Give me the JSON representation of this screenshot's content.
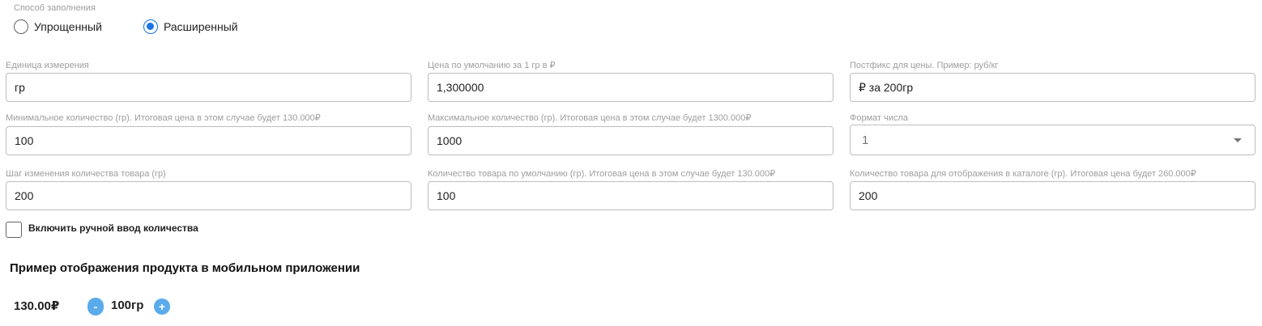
{
  "fill_mode": {
    "label": "Способ заполнения",
    "options": [
      {
        "label": "Упрощенный",
        "checked": false
      },
      {
        "label": "Расширенный",
        "checked": true
      }
    ]
  },
  "fields": {
    "unit": {
      "label": "Единица измерения",
      "value": "гр"
    },
    "default_price": {
      "label": "Цена по умолчанию за 1 гр в ₽",
      "value": "1,300000"
    },
    "price_postfix": {
      "label": "Постфикс для цены. Пример: руб/кг",
      "value": "₽ за 200гр"
    },
    "min_qty": {
      "label": "Минимальное количество (гр). Итоговая цена в этом случае будет 130.000₽",
      "value": "100"
    },
    "max_qty": {
      "label": "Максимальное количество (гр). Итоговая цена в этом случае будет 1300.000₽",
      "value": "1000"
    },
    "number_format": {
      "label": "Формат числа",
      "value": "1"
    },
    "qty_step": {
      "label": "Шаг изменения количества товара (гр)",
      "value": "200"
    },
    "default_qty": {
      "label": "Количество товара по умолчанию (гр). Итоговая цена в этом случае будет 130.000₽",
      "value": "100"
    },
    "catalog_qty": {
      "label": "Количество товара для отображения в каталоге (гр). Итоговая цена будет 260.000₽",
      "value": "200"
    }
  },
  "manual_input": {
    "label": "Включить ручной ввод количества",
    "checked": false
  },
  "preview": {
    "title": "Пример отображения продукта в мобильном приложении",
    "price": "130.00₽",
    "minus": "-",
    "quantity": "100гр",
    "plus": "+"
  },
  "colors": {
    "accent": "#1a73e8",
    "stepper": "#5aabec",
    "border": "#bdbdbd",
    "label": "#9e9e9e"
  },
  "icons": {
    "dropdown": "chevron-down-icon",
    "minus": "minus-icon",
    "plus": "plus-icon"
  }
}
